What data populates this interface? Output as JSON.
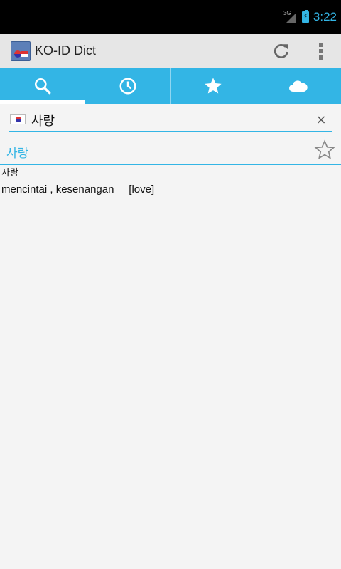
{
  "status_bar": {
    "network": "3G",
    "time": "3:22"
  },
  "action_bar": {
    "title": "KO-ID Dict",
    "icons": [
      "app-icon",
      "refresh-icon",
      "overflow-menu-icon"
    ]
  },
  "tabs": [
    {
      "icon": "search-icon",
      "active": true
    },
    {
      "icon": "clock-icon",
      "active": false
    },
    {
      "icon": "star-icon",
      "active": false
    },
    {
      "icon": "cloud-icon",
      "active": false
    }
  ],
  "search": {
    "value": "사랑",
    "flag_icon": "korea-flag-icon",
    "clear_label": "×"
  },
  "result": {
    "word": "사랑",
    "favorite_icon": "star-outline-icon",
    "definition": {
      "headword": "사랑",
      "text": "mencintai , kesenangan     [love]"
    }
  },
  "colors": {
    "accent": "#33b5e5",
    "status_bar": "#000000",
    "action_bar": "#e6e6e6",
    "background": "#f4f4f4"
  }
}
